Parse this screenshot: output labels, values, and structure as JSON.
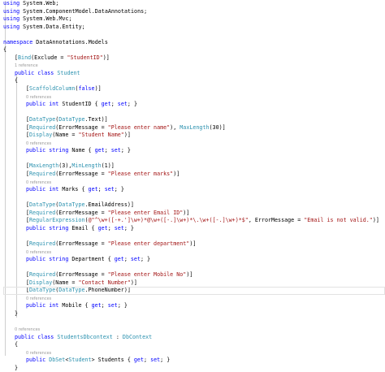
{
  "colors": {
    "keyword": "#0000ff",
    "type": "#2b91af",
    "string": "#a31515",
    "text": "#000000",
    "codelens": "#9a9a9a",
    "background": "#ffffff"
  },
  "code_lines": [
    {
      "kind": "code",
      "indent": 0,
      "tokens": [
        {
          "t": "using",
          "c": "kw"
        },
        {
          "t": " System.Web;",
          "c": "pl"
        }
      ]
    },
    {
      "kind": "code",
      "indent": 0,
      "tokens": [
        {
          "t": "using",
          "c": "kw"
        },
        {
          "t": " System.ComponentModel.DataAnnotations;",
          "c": "pl"
        }
      ]
    },
    {
      "kind": "code",
      "indent": 0,
      "tokens": [
        {
          "t": "using",
          "c": "kw"
        },
        {
          "t": " System.Web.Mvc;",
          "c": "pl"
        }
      ]
    },
    {
      "kind": "code",
      "indent": 0,
      "tokens": [
        {
          "t": "using",
          "c": "kw"
        },
        {
          "t": " System.Data.Entity;",
          "c": "pl"
        }
      ]
    },
    {
      "kind": "blank"
    },
    {
      "kind": "code",
      "indent": 0,
      "tokens": [
        {
          "t": "namespace",
          "c": "kw"
        },
        {
          "t": " DataAnnotations.Models",
          "c": "pl"
        }
      ]
    },
    {
      "kind": "code",
      "indent": 0,
      "tokens": [
        {
          "t": "{",
          "c": "pl"
        }
      ]
    },
    {
      "kind": "code",
      "indent": 1,
      "tokens": [
        {
          "t": "[",
          "c": "pl"
        },
        {
          "t": "Bind",
          "c": "ty"
        },
        {
          "t": "(Exclude = ",
          "c": "pl"
        },
        {
          "t": "\"StudentID\"",
          "c": "st"
        },
        {
          "t": ")]",
          "c": "pl"
        }
      ]
    },
    {
      "kind": "ref",
      "indent": 1,
      "text": "1 reference"
    },
    {
      "kind": "code",
      "indent": 1,
      "tokens": [
        {
          "t": "public",
          "c": "kw"
        },
        {
          "t": " ",
          "c": "pl"
        },
        {
          "t": "class",
          "c": "kw"
        },
        {
          "t": " ",
          "c": "pl"
        },
        {
          "t": "Student",
          "c": "ty"
        }
      ]
    },
    {
      "kind": "code",
      "indent": 1,
      "tokens": [
        {
          "t": "{",
          "c": "pl"
        }
      ]
    },
    {
      "kind": "code",
      "indent": 2,
      "tokens": [
        {
          "t": "[",
          "c": "pl"
        },
        {
          "t": "ScaffoldColumn",
          "c": "ty"
        },
        {
          "t": "(",
          "c": "pl"
        },
        {
          "t": "false",
          "c": "kw"
        },
        {
          "t": ")]",
          "c": "pl"
        }
      ]
    },
    {
      "kind": "ref",
      "indent": 2,
      "text": "0 references"
    },
    {
      "kind": "code",
      "indent": 2,
      "tokens": [
        {
          "t": "public",
          "c": "kw"
        },
        {
          "t": " ",
          "c": "pl"
        },
        {
          "t": "int",
          "c": "kw"
        },
        {
          "t": " StudentID { ",
          "c": "pl"
        },
        {
          "t": "get",
          "c": "kw"
        },
        {
          "t": "; ",
          "c": "pl"
        },
        {
          "t": "set",
          "c": "kw"
        },
        {
          "t": "; }",
          "c": "pl"
        }
      ]
    },
    {
      "kind": "blank"
    },
    {
      "kind": "code",
      "indent": 2,
      "tokens": [
        {
          "t": "[",
          "c": "pl"
        },
        {
          "t": "DataType",
          "c": "ty"
        },
        {
          "t": "(",
          "c": "pl"
        },
        {
          "t": "DataType",
          "c": "ty"
        },
        {
          "t": ".Text)]",
          "c": "pl"
        }
      ]
    },
    {
      "kind": "code",
      "indent": 2,
      "tokens": [
        {
          "t": "[",
          "c": "pl"
        },
        {
          "t": "Required",
          "c": "ty"
        },
        {
          "t": "(ErrorMessage = ",
          "c": "pl"
        },
        {
          "t": "\"Please enter name\"",
          "c": "st"
        },
        {
          "t": "), ",
          "c": "pl"
        },
        {
          "t": "MaxLength",
          "c": "ty"
        },
        {
          "t": "(30)]",
          "c": "pl"
        }
      ]
    },
    {
      "kind": "code",
      "indent": 2,
      "tokens": [
        {
          "t": "[",
          "c": "pl"
        },
        {
          "t": "Display",
          "c": "ty"
        },
        {
          "t": "(Name = ",
          "c": "pl"
        },
        {
          "t": "\"Student Name\"",
          "c": "st"
        },
        {
          "t": ")]",
          "c": "pl"
        }
      ]
    },
    {
      "kind": "ref",
      "indent": 2,
      "text": "0 references"
    },
    {
      "kind": "code",
      "indent": 2,
      "tokens": [
        {
          "t": "public",
          "c": "kw"
        },
        {
          "t": " ",
          "c": "pl"
        },
        {
          "t": "string",
          "c": "kw"
        },
        {
          "t": " Name { ",
          "c": "pl"
        },
        {
          "t": "get",
          "c": "kw"
        },
        {
          "t": "; ",
          "c": "pl"
        },
        {
          "t": "set",
          "c": "kw"
        },
        {
          "t": "; }",
          "c": "pl"
        }
      ]
    },
    {
      "kind": "blank"
    },
    {
      "kind": "code",
      "indent": 2,
      "tokens": [
        {
          "t": "[",
          "c": "pl"
        },
        {
          "t": "MaxLength",
          "c": "ty"
        },
        {
          "t": "(3),",
          "c": "pl"
        },
        {
          "t": "MinLength",
          "c": "ty"
        },
        {
          "t": "(1)]",
          "c": "pl"
        }
      ]
    },
    {
      "kind": "code",
      "indent": 2,
      "tokens": [
        {
          "t": "[",
          "c": "pl"
        },
        {
          "t": "Required",
          "c": "ty"
        },
        {
          "t": "(ErrorMessage = ",
          "c": "pl"
        },
        {
          "t": "\"Please enter marks\"",
          "c": "st"
        },
        {
          "t": ")]",
          "c": "pl"
        }
      ]
    },
    {
      "kind": "ref",
      "indent": 2,
      "text": "0 references"
    },
    {
      "kind": "code",
      "indent": 2,
      "tokens": [
        {
          "t": "public",
          "c": "kw"
        },
        {
          "t": " ",
          "c": "pl"
        },
        {
          "t": "int",
          "c": "kw"
        },
        {
          "t": " Marks { ",
          "c": "pl"
        },
        {
          "t": "get",
          "c": "kw"
        },
        {
          "t": "; ",
          "c": "pl"
        },
        {
          "t": "set",
          "c": "kw"
        },
        {
          "t": "; }",
          "c": "pl"
        }
      ]
    },
    {
      "kind": "blank"
    },
    {
      "kind": "code",
      "indent": 2,
      "tokens": [
        {
          "t": "[",
          "c": "pl"
        },
        {
          "t": "DataType",
          "c": "ty"
        },
        {
          "t": "(",
          "c": "pl"
        },
        {
          "t": "DataType",
          "c": "ty"
        },
        {
          "t": ".EmailAddress)]",
          "c": "pl"
        }
      ]
    },
    {
      "kind": "code",
      "indent": 2,
      "tokens": [
        {
          "t": "[",
          "c": "pl"
        },
        {
          "t": "Required",
          "c": "ty"
        },
        {
          "t": "(ErrorMessage = ",
          "c": "pl"
        },
        {
          "t": "\"Please enter Email ID\"",
          "c": "st"
        },
        {
          "t": ")]",
          "c": "pl"
        }
      ]
    },
    {
      "kind": "code",
      "indent": 2,
      "tokens": [
        {
          "t": "[",
          "c": "pl"
        },
        {
          "t": "RegularExpression",
          "c": "ty"
        },
        {
          "t": "(",
          "c": "pl"
        },
        {
          "t": "@\"^\\w+([-+.']\\w+)*@\\w+([-.]\\w+)*\\.\\w+([-.]\\w+)*$\"",
          "c": "st"
        },
        {
          "t": ", ErrorMessage = ",
          "c": "pl"
        },
        {
          "t": "\"Email is not valid.\"",
          "c": "st"
        },
        {
          "t": ")]",
          "c": "pl"
        }
      ]
    },
    {
      "kind": "code",
      "indent": 2,
      "tokens": [
        {
          "t": "public",
          "c": "kw"
        },
        {
          "t": " ",
          "c": "pl"
        },
        {
          "t": "string",
          "c": "kw"
        },
        {
          "t": " Email { ",
          "c": "pl"
        },
        {
          "t": "get",
          "c": "kw"
        },
        {
          "t": "; ",
          "c": "pl"
        },
        {
          "t": "set",
          "c": "kw"
        },
        {
          "t": "; }",
          "c": "pl"
        }
      ]
    },
    {
      "kind": "blank"
    },
    {
      "kind": "code",
      "indent": 2,
      "tokens": [
        {
          "t": "[",
          "c": "pl"
        },
        {
          "t": "Required",
          "c": "ty"
        },
        {
          "t": "(ErrorMessage = ",
          "c": "pl"
        },
        {
          "t": "\"Please enter department\"",
          "c": "st"
        },
        {
          "t": ")]",
          "c": "pl"
        }
      ]
    },
    {
      "kind": "ref",
      "indent": 2,
      "text": "0 references"
    },
    {
      "kind": "code",
      "indent": 2,
      "tokens": [
        {
          "t": "public",
          "c": "kw"
        },
        {
          "t": " ",
          "c": "pl"
        },
        {
          "t": "string",
          "c": "kw"
        },
        {
          "t": " Department { ",
          "c": "pl"
        },
        {
          "t": "get",
          "c": "kw"
        },
        {
          "t": "; ",
          "c": "pl"
        },
        {
          "t": "set",
          "c": "kw"
        },
        {
          "t": "; }",
          "c": "pl"
        }
      ]
    },
    {
      "kind": "blank"
    },
    {
      "kind": "code",
      "indent": 2,
      "tokens": [
        {
          "t": "[",
          "c": "pl"
        },
        {
          "t": "Required",
          "c": "ty"
        },
        {
          "t": "(ErrorMessage = ",
          "c": "pl"
        },
        {
          "t": "\"Please enter Mobile No\"",
          "c": "st"
        },
        {
          "t": ")]",
          "c": "pl"
        }
      ]
    },
    {
      "kind": "code",
      "indent": 2,
      "tokens": [
        {
          "t": "[",
          "c": "pl"
        },
        {
          "t": "Display",
          "c": "ty"
        },
        {
          "t": "(Name = ",
          "c": "pl"
        },
        {
          "t": "\"Contact Number\"",
          "c": "st"
        },
        {
          "t": ")]",
          "c": "pl"
        }
      ]
    },
    {
      "kind": "code",
      "indent": 2,
      "caret": true,
      "tokens": [
        {
          "t": "[",
          "c": "pl"
        },
        {
          "t": "DataType",
          "c": "ty"
        },
        {
          "t": "(",
          "c": "pl"
        },
        {
          "t": "DataType",
          "c": "ty"
        },
        {
          "t": ".PhoneNumber)]",
          "c": "pl"
        }
      ]
    },
    {
      "kind": "ref",
      "indent": 2,
      "text": "0 references"
    },
    {
      "kind": "code",
      "indent": 2,
      "tokens": [
        {
          "t": "public",
          "c": "kw"
        },
        {
          "t": " ",
          "c": "pl"
        },
        {
          "t": "int",
          "c": "kw"
        },
        {
          "t": " Mobile { ",
          "c": "pl"
        },
        {
          "t": "get",
          "c": "kw"
        },
        {
          "t": "; ",
          "c": "pl"
        },
        {
          "t": "set",
          "c": "kw"
        },
        {
          "t": "; }",
          "c": "pl"
        }
      ]
    },
    {
      "kind": "code",
      "indent": 1,
      "tokens": [
        {
          "t": "}",
          "c": "pl"
        }
      ]
    },
    {
      "kind": "blank"
    },
    {
      "kind": "ref",
      "indent": 1,
      "text": "0 references"
    },
    {
      "kind": "code",
      "indent": 1,
      "tokens": [
        {
          "t": "public",
          "c": "kw"
        },
        {
          "t": " ",
          "c": "pl"
        },
        {
          "t": "class",
          "c": "kw"
        },
        {
          "t": " ",
          "c": "pl"
        },
        {
          "t": "StudentsDbcontext",
          "c": "ty"
        },
        {
          "t": " : ",
          "c": "pl"
        },
        {
          "t": "DbContext",
          "c": "ty"
        }
      ]
    },
    {
      "kind": "code",
      "indent": 1,
      "tokens": [
        {
          "t": "{",
          "c": "pl"
        }
      ]
    },
    {
      "kind": "ref",
      "indent": 2,
      "text": "0 references"
    },
    {
      "kind": "code",
      "indent": 2,
      "tokens": [
        {
          "t": "public",
          "c": "kw"
        },
        {
          "t": " ",
          "c": "pl"
        },
        {
          "t": "DbSet",
          "c": "ty"
        },
        {
          "t": "<",
          "c": "pl"
        },
        {
          "t": "Student",
          "c": "ty"
        },
        {
          "t": "> Students { ",
          "c": "pl"
        },
        {
          "t": "get",
          "c": "kw"
        },
        {
          "t": "; ",
          "c": "pl"
        },
        {
          "t": "set",
          "c": "kw"
        },
        {
          "t": "; }",
          "c": "pl"
        }
      ]
    },
    {
      "kind": "code",
      "indent": 1,
      "tokens": [
        {
          "t": "}",
          "c": "pl"
        }
      ]
    }
  ]
}
